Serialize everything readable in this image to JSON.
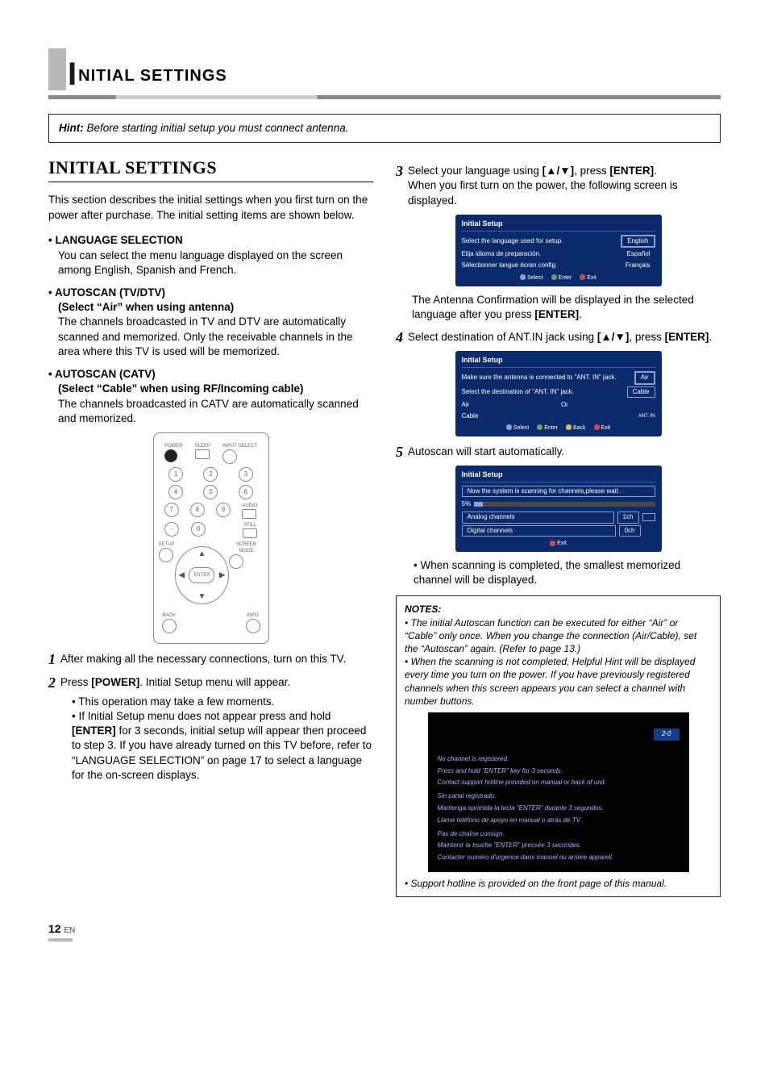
{
  "title": {
    "initial": "I",
    "rest": "NITIAL SETTINGS"
  },
  "hint": {
    "label": "Hint:",
    "text": "Before starting initial setup you must connect antenna."
  },
  "section_head": "INITIAL SETTINGS",
  "intro": "This section describes the initial settings when you first turn on the power after purchase. The initial setting items are shown below.",
  "lang_sel": {
    "head": "• LANGUAGE SELECTION",
    "body": "You can select the menu language displayed on the screen among English, Spanish and French."
  },
  "auto_tv": {
    "head": "• AUTOSCAN (TV/DTV)",
    "sub": "(Select “Air” when using antenna)",
    "body": "The channels broadcasted in TV and DTV are automatically scanned and memorized. Only the receivable channels in the area where this TV is used will be memorized."
  },
  "auto_catv": {
    "head": "• AUTOSCAN (CATV)",
    "sub": "(Select “Cable” when using RF/Incoming cable)",
    "body": "The channels broadcasted in CATV are automatically scanned and memorized."
  },
  "remote": {
    "power": "POWER",
    "sleep": "SLEEP",
    "input": "INPUT SELECT",
    "nums": [
      "1",
      "2",
      "3",
      "4",
      "5",
      "6",
      "7",
      "8",
      "9",
      "-",
      "0"
    ],
    "audio": "AUDIO",
    "still": "STILL",
    "screen": "SCREEN MODE",
    "setup": "SETUP",
    "enter": "ENTER",
    "back": "BACK",
    "info": "INFO"
  },
  "step1": {
    "n": "1",
    "text": "After making all the necessary connections, turn on this TV."
  },
  "step2": {
    "n": "2",
    "text_a": "Press ",
    "b1": "[POWER]",
    "text_b": ". Initial Setup menu will appear.",
    "bul1": "This operation may take a few moments.",
    "bul2_a": "If Initial Setup menu does not appear press and hold ",
    "bul2_b": "[ENTER]",
    "bul2_c": " for 3 seconds, initial setup will appear then proceed to step 3. If you have already turned on this TV before, refer to “LANGUAGE SELECTION” on page 17 to select a language for the on-screen displays."
  },
  "step3": {
    "n": "3",
    "a": "Select your language using ",
    "b1": "[▲/▼]",
    "b": ", press ",
    "b2": "[ENTER]",
    "c": ".",
    "d": "When you first turn on the power, the following screen is displayed.",
    "osd_title": "Initial Setup",
    "l1": "Select the language used for setup.",
    "o1": "English",
    "l2": "Elija idioma de preparación.",
    "o2": "Español",
    "l3": "Sélectionner langue écran config.",
    "o3": "Français",
    "f_sel": "Select",
    "f_ent": "Enter",
    "f_exit": "Exit",
    "after_a": "The Antenna Confirmation will be displayed in the selected language after you press ",
    "after_b": "[ENTER]",
    "after_c": "."
  },
  "step4": {
    "n": "4",
    "a": "Select destination of ANT.IN jack using ",
    "b1": "[▲/▼]",
    "b": ", press ",
    "b2": "[ENTER]",
    "c": ".",
    "osd_title": "Initial Setup",
    "l1": "Make sure the antenna is connected to \"ANT. IN\" jack.",
    "l2": "Select the destination of \"ANT. IN\" jack.",
    "air": "Air",
    "cable": "Cable",
    "or": "Or",
    "ant": "ANT. IN",
    "f_sel": "Select",
    "f_ent": "Enter",
    "f_back": "Back",
    "f_exit": "Exit"
  },
  "step5": {
    "n": "5",
    "a": "Autoscan will start automatically.",
    "osd_title": "Initial Setup",
    "msg": "Now the system is scanning for channels,please wait.",
    "pct": "5%",
    "an": "Analog channels",
    "an_v": "1ch",
    "dg": "Digital channels",
    "dg_v": "0ch",
    "f_exit": "Exit",
    "done": "When scanning is completed, the smallest memorized channel will be displayed."
  },
  "notes": {
    "head": "NOTES:",
    "n1": "The initial Autoscan function can be executed for either “Air” or “Cable” only once. When you change the connection (Air/Cable), set the “Autoscan” again. (Refer to page 13.)",
    "n2": "When the scanning is not completed, Helpful Hint will be displayed every time you turn on the power. If you have previously registered channels when this screen appears you can select a channel with number buttons.",
    "ch": "2-0",
    "en1": "No channel is registered.",
    "en2": "Press and hold \"ENTER\" key for 3 seconds.",
    "en3": "Contact support hotline provided on manual or back of unit.",
    "es1": "Sin canal registrado.",
    "es2": "Mantenga oprimida la tecla \"ENTER\" durante 3 segundos.",
    "es3": "Llame teléfono de apoyo en manual o atrás de TV.",
    "fr1": "Pas de chaîne consign.",
    "fr2": "Maintenir la touche \"ENTER\" pressée 3 secondes.",
    "fr3": "Contacter numéro d'urgence dans manuel ou arrière appareil.",
    "n3": "Support hotline is provided on the front page of this manual."
  },
  "page_num": "12",
  "page_lang": "EN"
}
